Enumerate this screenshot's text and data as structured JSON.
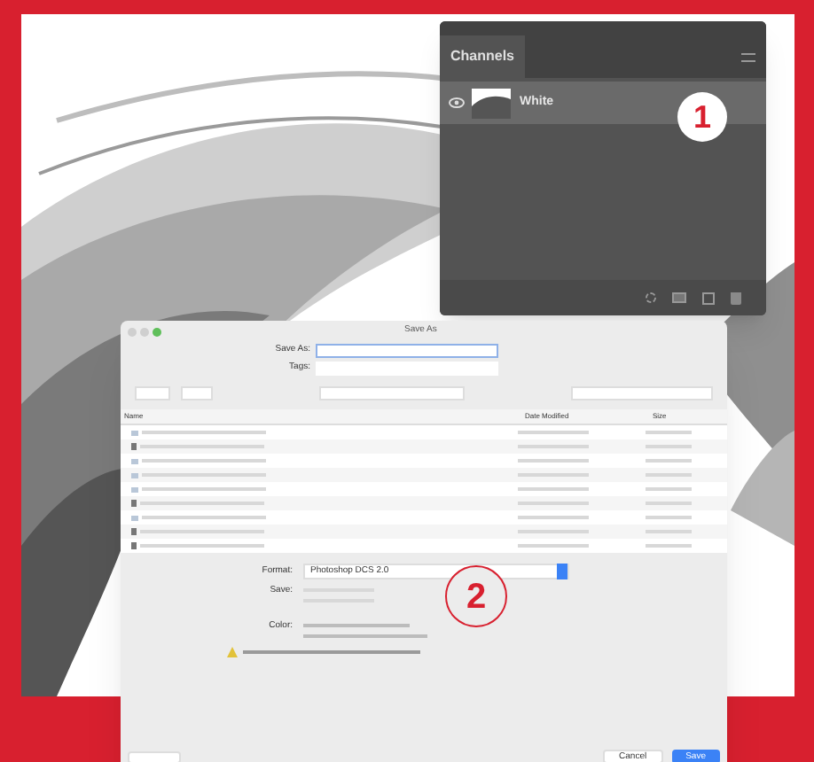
{
  "channels_panel": {
    "title": "Channels",
    "channels": [
      {
        "name": "White",
        "visible": true,
        "selected": true
      }
    ],
    "callout": "1"
  },
  "save_dialog": {
    "title": "Save As",
    "save_as_label": "Save As:",
    "tags_label": "Tags:",
    "columns": [
      "Name",
      "Date Modified",
      "Size"
    ],
    "rows": [
      {
        "kind": "folder"
      },
      {
        "kind": "file"
      },
      {
        "kind": "folder"
      },
      {
        "kind": "folder"
      },
      {
        "kind": "folder"
      },
      {
        "kind": "file"
      },
      {
        "kind": "folder"
      },
      {
        "kind": "file"
      },
      {
        "kind": "file"
      }
    ],
    "format_label": "Format:",
    "format_value": "Photoshop DCS 2.0",
    "save_label": "Save:",
    "color_label": "Color:",
    "callout": "2",
    "buttons": [
      {
        "label": "Cancel",
        "primary": false
      },
      {
        "label": "Save",
        "primary": true
      }
    ]
  }
}
